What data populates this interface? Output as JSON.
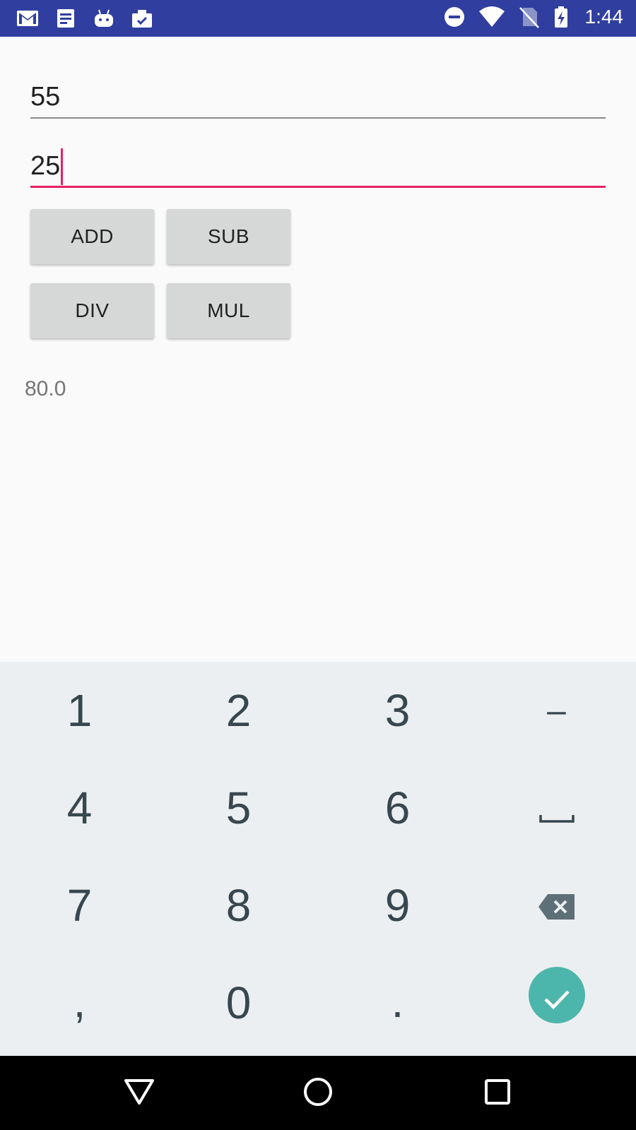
{
  "status_bar": {
    "time": "1:44",
    "left_icons": [
      "gmail-icon",
      "notes-icon",
      "android-icon",
      "clipboard-check-icon"
    ],
    "right_icons": [
      "do-not-disturb-icon",
      "wifi-icon",
      "no-sim-icon",
      "battery-charging-icon"
    ],
    "background": "#303f9f"
  },
  "inputs": {
    "first_value": "55",
    "second_value": "25",
    "focus_color": "#e91e63"
  },
  "buttons": {
    "add": "ADD",
    "sub": "SUB",
    "div": "DIV",
    "mul": "MUL"
  },
  "result": "80.0",
  "keyboard": {
    "rows": [
      [
        "1",
        "2",
        "3",
        "–"
      ],
      [
        "4",
        "5",
        "6",
        "space"
      ],
      [
        "7",
        "8",
        "9",
        "backspace"
      ],
      [
        ",",
        "0",
        ".",
        "enter"
      ]
    ],
    "k1": "1",
    "k2": "2",
    "k3": "3",
    "kminus": "–",
    "k4": "4",
    "k5": "5",
    "k6": "6",
    "k7": "7",
    "k8": "8",
    "k9": "9",
    "kcomma": ",",
    "k0": "0",
    "kdot": ".",
    "enter_color": "#4db6ac"
  },
  "nav_bar": {
    "buttons": [
      "back-icon",
      "home-icon",
      "recents-icon"
    ]
  }
}
